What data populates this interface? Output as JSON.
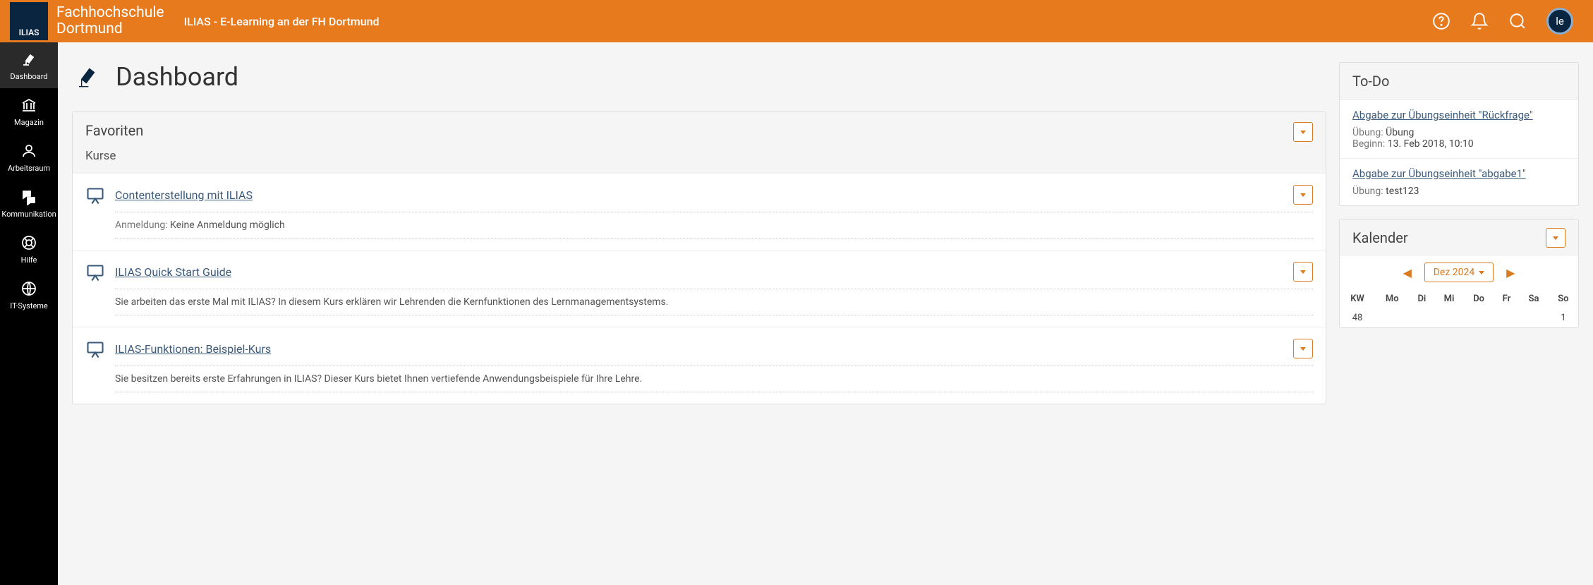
{
  "header": {
    "logo_square": "ILIAS",
    "logo_line1": "Fachhochschule",
    "logo_line2": "Dortmund",
    "title": "ILIAS - E-Learning an der FH Dortmund",
    "avatar": "le"
  },
  "sidebar": {
    "items": [
      {
        "label": "Dashboard"
      },
      {
        "label": "Magazin"
      },
      {
        "label": "Arbeitsraum"
      },
      {
        "label": "Kommunikation"
      },
      {
        "label": "Hilfe"
      },
      {
        "label": "IT-Systeme"
      }
    ]
  },
  "page": {
    "title": "Dashboard"
  },
  "favorites": {
    "title": "Favoriten",
    "subtitle": "Kurse",
    "items": [
      {
        "title": "Contenterstellung mit ILIAS",
        "meta_label": "Anmeldung: ",
        "meta_value": "Keine Anmeldung möglich"
      },
      {
        "title": "ILIAS Quick Start Guide",
        "description": "Sie arbeiten das erste Mal mit ILIAS? In diesem Kurs erklären wir Lehrenden die Kernfunktionen des Lernmanagementsystems."
      },
      {
        "title": "ILIAS-Funktionen: Beispiel-Kurs",
        "description": "Sie besitzen bereits erste Erfahrungen in ILIAS? Dieser Kurs bietet Ihnen vertiefende Anwendungsbeispiele für Ihre Lehre."
      }
    ]
  },
  "todo": {
    "title": "To-Do",
    "items": [
      {
        "title": "Abgabe zur Übungseinheit \"Rückfrage\"",
        "line1_label": "Übung: ",
        "line1_value": "Übung",
        "line2_label": "Beginn: ",
        "line2_value": "13. Feb 2018, 10:10"
      },
      {
        "title": "Abgabe zur Übungseinheit \"abgabe1\"",
        "line1_label": "Übung: ",
        "line1_value": "test123"
      }
    ]
  },
  "calendar": {
    "title": "Kalender",
    "month": "Dez 2024",
    "head": [
      "KW",
      "Mo",
      "Di",
      "Mi",
      "Do",
      "Fr",
      "Sa",
      "So"
    ],
    "row1": [
      "48",
      "",
      "",
      "",
      "",
      "",
      "",
      "1"
    ]
  }
}
